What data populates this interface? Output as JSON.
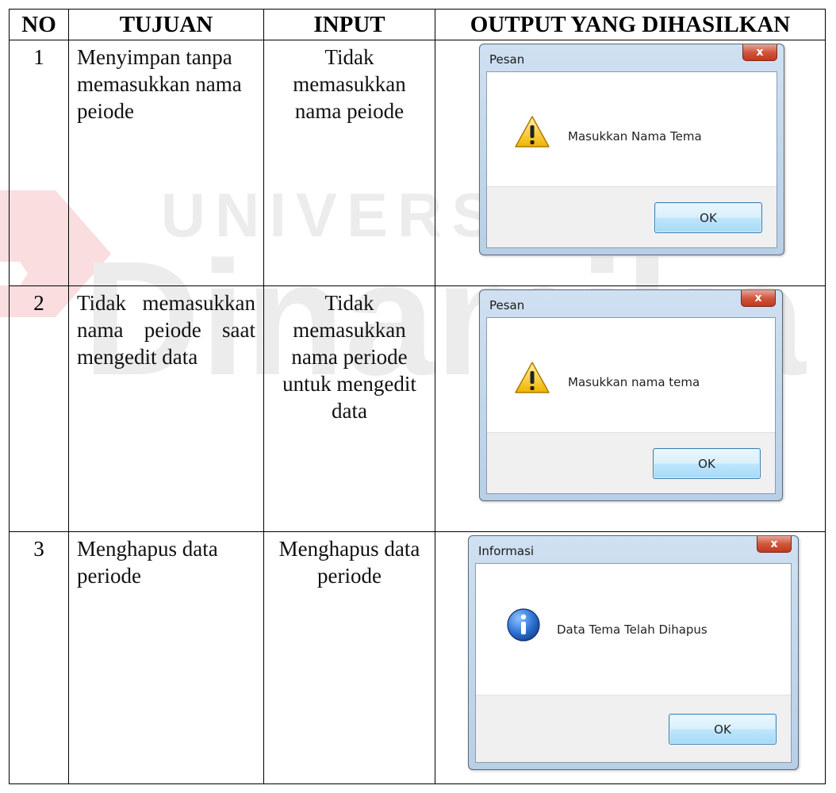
{
  "table": {
    "headers": {
      "no": "NO",
      "tujuan": "TUJUAN",
      "input": "INPUT",
      "output": "OUTPUT YANG DIHASILKAN"
    },
    "rows": [
      {
        "no": "1",
        "tujuan": "Menyimpan tanpa memasukkan nama peiode",
        "input": "Tidak memasukkan nama peiode",
        "dialog": {
          "title": "Pesan",
          "close": "x",
          "message": "Masukkan Nama Tema",
          "ok": "OK",
          "icon": "warning-icon"
        }
      },
      {
        "no": "2",
        "tujuan": "Tidak memasukkan nama peiode saat mengedit data",
        "input": "Tidak memasukkan nama periode untuk mengedit data",
        "dialog": {
          "title": "Pesan",
          "close": "x",
          "message": "Masukkan nama tema",
          "ok": "OK",
          "icon": "warning-icon"
        }
      },
      {
        "no": "3",
        "tujuan": "Menghapus data periode",
        "input": "Menghapus data periode",
        "dialog": {
          "title": "Informasi",
          "close": "x",
          "message": "Data Tema Telah Dihapus",
          "ok": "OK",
          "icon": "info-icon"
        }
      }
    ]
  },
  "watermark": {
    "line1": "UNIVERSITAS",
    "line2": "Dinamika",
    "color_red": "#e8474c",
    "color_gray": "#9a9a9a"
  }
}
